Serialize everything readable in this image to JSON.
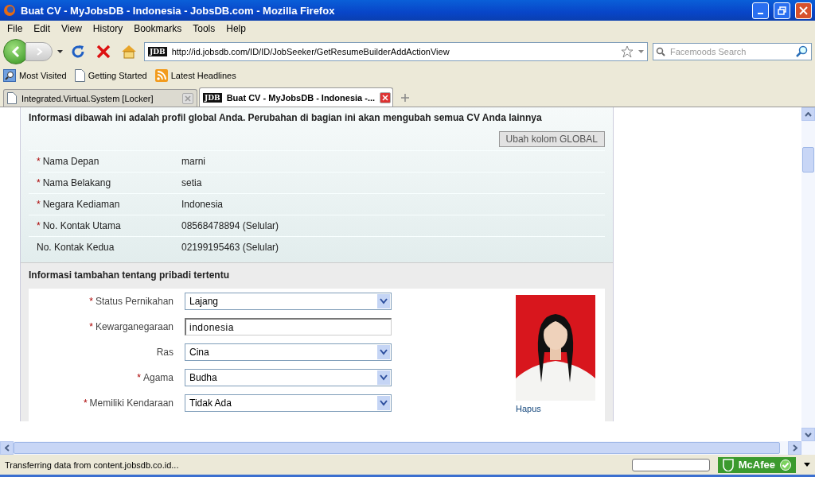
{
  "window": {
    "title": "Buat CV - MyJobsDB - Indonesia - JobsDB.com - Mozilla Firefox"
  },
  "menu": [
    "File",
    "Edit",
    "View",
    "History",
    "Bookmarks",
    "Tools",
    "Help"
  ],
  "address_bar": {
    "site_badge": "JDB",
    "value": "http://id.jobsdb.com/ID/ID/JobSeeker/GetResumeBuilderAddActionView"
  },
  "search": {
    "placeholder": "Facemoods Search"
  },
  "bookmarks": [
    {
      "label": "Most Visited",
      "kind": "search"
    },
    {
      "label": "Getting Started",
      "kind": "page"
    },
    {
      "label": "Latest Headlines",
      "kind": "feed"
    }
  ],
  "tabs": [
    {
      "label": "Integrated.Virtual.System [Locker]",
      "selected": false
    },
    {
      "label": "Buat CV - MyJobsDB - Indonesia -...",
      "selected": true,
      "site_badge": "JDB"
    }
  ],
  "global_profile": {
    "required_mark": "*",
    "notice": "Informasi dibawah ini adalah profil global Anda. Perubahan di bagian ini akan mengubah semua CV Anda lainnya",
    "button": "Ubah kolom GLOBAL",
    "rows": [
      {
        "label": "Nama Depan",
        "value": "marni",
        "required": true
      },
      {
        "label": "Nama Belakang",
        "value": "setia",
        "required": true
      },
      {
        "label": "Negara Kediaman",
        "value": "Indonesia",
        "required": true
      },
      {
        "label": "No. Kontak Utama",
        "value": "08568478894 (Selular)",
        "required": true
      },
      {
        "label": "No. Kontak Kedua",
        "value": "02199195463 (Selular)",
        "required": false
      }
    ]
  },
  "personal": {
    "required_mark": "*",
    "heading": "Informasi tambahan tentang pribadi tertentu",
    "fields": [
      {
        "label": "Status Pernikahan",
        "value": "Lajang",
        "required": true,
        "kind": "select"
      },
      {
        "label": "Kewarganegaraan",
        "value": "indonesia",
        "required": true,
        "kind": "text"
      },
      {
        "label": "Ras",
        "value": "Cina",
        "required": false,
        "kind": "select"
      },
      {
        "label": "Agama",
        "value": "Budha",
        "required": true,
        "kind": "select"
      },
      {
        "label": "Memiliki Kendaraan",
        "value": "Tidak Ada",
        "required": true,
        "kind": "select"
      }
    ],
    "photo": {
      "kind": "picture",
      "link": "Hapus"
    }
  },
  "status_bar": {
    "text": "Transferring data from content.jobsdb.co.id...",
    "addon": "McAfee"
  }
}
